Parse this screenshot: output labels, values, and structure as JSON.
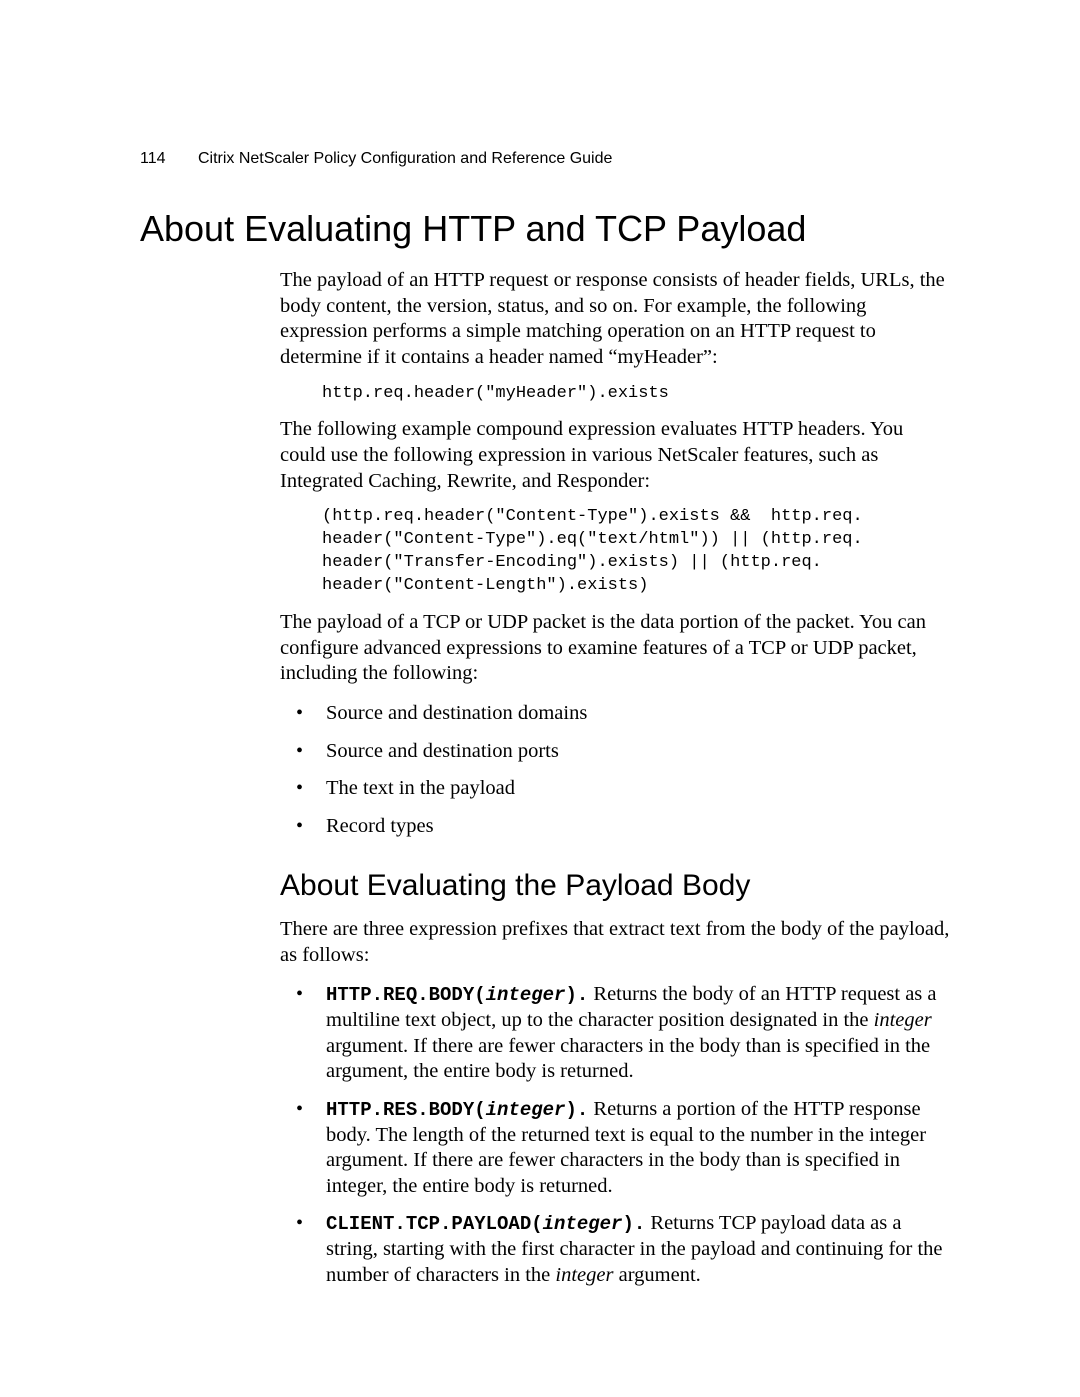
{
  "header": {
    "page_number": "114",
    "guide_title": "Citrix NetScaler Policy Configuration and Reference Guide"
  },
  "title": "About Evaluating HTTP and TCP Payload",
  "intro_para": "The payload of an HTTP request or response consists of header fields, URLs, the body content, the version, status, and so on. For example, the following expression performs a simple matching operation on an HTTP request to determine if it contains a header named “myHeader”:",
  "code1": "http.req.header(\"myHeader\").exists",
  "para2": "The following example compound expression evaluates HTTP headers. You could use the following expression in various NetScaler features, such as Integrated Caching, Rewrite, and Responder:",
  "code2": "(http.req.header(\"Content-Type\").exists &&  http.req.\nheader(\"Content-Type\").eq(\"text/html\")) || (http.req.\nheader(\"Transfer-Encoding\").exists) || (http.req.\nheader(\"Content-Length\").exists)",
  "para3": "The payload of a TCP or UDP packet is the data portion of the packet. You can configure advanced expressions to examine features of a TCP or UDP packet, including the following:",
  "bullets_plain": [
    "Source and destination domains",
    "Source and destination ports",
    "The text in the payload",
    "Record types"
  ],
  "subtitle": "About Evaluating the Payload Body",
  "sub_intro": "There are three expression prefixes that extract text from the body of the payload, as follows:",
  "def_bullets": [
    {
      "prefix": "HTTP.REQ.BODY(",
      "param": "integer",
      "suffix": ").",
      "text_before_italic": "Returns the body of an HTTP request as a multiline text object, up to the character position designated in the ",
      "italic_word": "integer",
      "text_after_italic": " argument. If there are fewer characters in the body than is specified in the argument, the entire body is returned."
    },
    {
      "prefix": "HTTP.RES.BODY(",
      "param": "integer",
      "suffix": ").",
      "text_before_italic": "Returns a portion of the HTTP response body. The length of the returned text is equal to the number in the integer argument. If there are fewer characters in the body than is specified in integer, the entire body is returned.",
      "italic_word": "",
      "text_after_italic": ""
    },
    {
      "prefix": "CLIENT.TCP.PAYLOAD(",
      "param": "integer",
      "suffix": ").",
      "text_before_italic": "Returns TCP payload data as a string, starting with the first character in the payload and continuing for the number of characters in the ",
      "italic_word": "integer",
      "text_after_italic": " argument."
    }
  ]
}
